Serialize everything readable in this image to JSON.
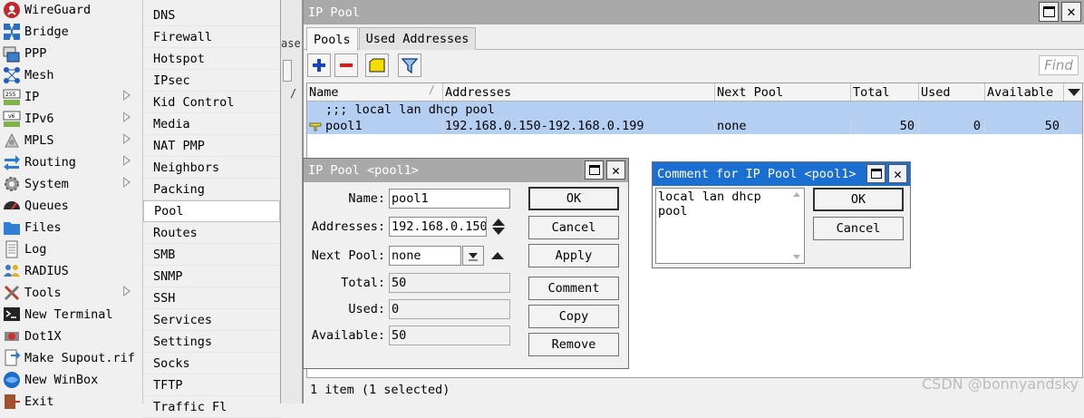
{
  "left_menu": {
    "items": [
      {
        "label": "WireGuard",
        "icon": "wireguard-icon",
        "submenu": false
      },
      {
        "label": "Bridge",
        "icon": "bridge-icon",
        "submenu": false
      },
      {
        "label": "PPP",
        "icon": "ppp-icon",
        "submenu": false
      },
      {
        "label": "Mesh",
        "icon": "mesh-icon",
        "submenu": false
      },
      {
        "label": "IP",
        "icon": "ip-icon",
        "submenu": true
      },
      {
        "label": "IPv6",
        "icon": "ipv6-icon",
        "submenu": true
      },
      {
        "label": "MPLS",
        "icon": "mpls-icon",
        "submenu": true
      },
      {
        "label": "Routing",
        "icon": "routing-icon",
        "submenu": true
      },
      {
        "label": "System",
        "icon": "system-gear-icon",
        "submenu": true
      },
      {
        "label": "Queues",
        "icon": "queues-icon",
        "submenu": false
      },
      {
        "label": "Files",
        "icon": "folder-icon",
        "submenu": false
      },
      {
        "label": "Log",
        "icon": "log-icon",
        "submenu": false
      },
      {
        "label": "RADIUS",
        "icon": "radius-users-icon",
        "submenu": false
      },
      {
        "label": "Tools",
        "icon": "tools-icon",
        "submenu": true
      },
      {
        "label": "New Terminal",
        "icon": "terminal-icon",
        "submenu": false
      },
      {
        "label": "Dot1X",
        "icon": "dot1x-icon",
        "submenu": false
      },
      {
        "label": "Make Supout.rif",
        "icon": "supout-icon",
        "submenu": false
      },
      {
        "label": "New WinBox",
        "icon": "winbox-icon",
        "submenu": false
      },
      {
        "label": "Exit",
        "icon": "exit-icon",
        "submenu": false
      }
    ]
  },
  "sub_menu": {
    "items": [
      "DNS",
      "Firewall",
      "Hotspot",
      "IPsec",
      "Kid Control",
      "Media",
      "NAT PMP",
      "Neighbors",
      "Packing",
      "Pool",
      "Routes",
      "SMB",
      "SNMP",
      "SSH",
      "Services",
      "Settings",
      "Socks",
      "TFTP",
      "Traffic Fl"
    ],
    "selected": "Pool"
  },
  "background_fragment": {
    "text": "ase",
    "slash": "/"
  },
  "pool_window": {
    "title": "IP Pool",
    "tabs": [
      "Pools",
      "Used Addresses"
    ],
    "find_placeholder": "Find",
    "columns": [
      "Name",
      "Addresses",
      "Next Pool",
      "Total",
      "Used",
      "Available"
    ],
    "comment_row": ";;; local lan dhcp pool",
    "rows": [
      {
        "name": "pool1",
        "addresses": "192.168.0.150-192.168.0.199",
        "next_pool": "none",
        "total": "50",
        "used": "0",
        "available": "50"
      }
    ],
    "status": "1 item (1 selected)",
    "watermark": "CSDN @bonnyandsky"
  },
  "pool_dialog": {
    "title": "IP Pool <pool1>",
    "fields": {
      "name_label": "Name:",
      "name_value": "pool1",
      "addresses_label": "Addresses:",
      "addresses_value": "192.168.0.150",
      "next_pool_label": "Next Pool:",
      "next_pool_value": "none",
      "total_label": "Total:",
      "total_value": "50",
      "used_label": "Used:",
      "used_value": "0",
      "available_label": "Available:",
      "available_value": "50"
    },
    "buttons": [
      "OK",
      "Cancel",
      "Apply",
      "Comment",
      "Copy",
      "Remove"
    ]
  },
  "comment_dialog": {
    "title": "Comment for IP Pool <pool1>",
    "comment_text_line1": "local lan dhcp",
    "comment_text_line2": "pool",
    "buttons": [
      "OK",
      "Cancel"
    ]
  },
  "colors": {
    "title_gray": "#a9a9a9",
    "active_title_blue": "#1a6fd1",
    "selection_blue": "#b4cff2"
  }
}
